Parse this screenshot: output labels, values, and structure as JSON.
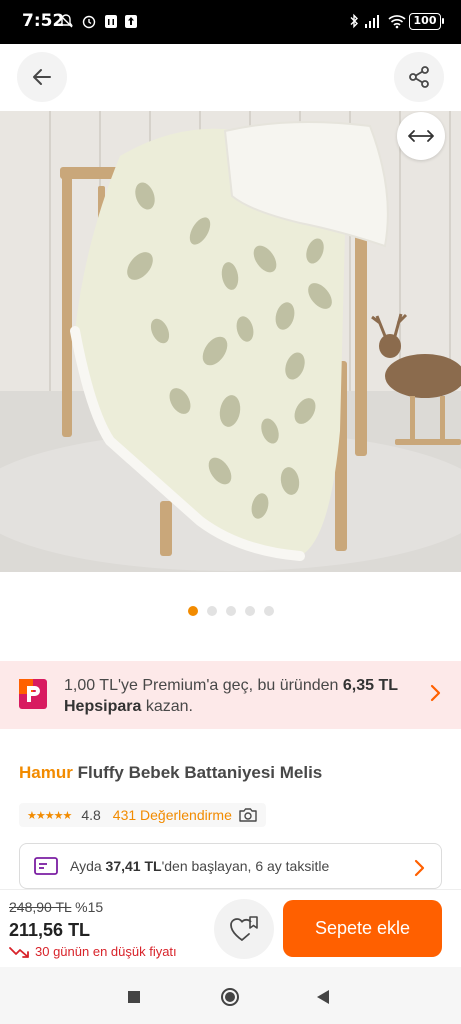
{
  "status_bar": {
    "time": "7:52",
    "battery": "100",
    "icons": [
      "mute-icon",
      "alarm-icon",
      "trash-icon",
      "upload-icon",
      "bluetooth-icon",
      "signal-icon",
      "wifi-icon"
    ]
  },
  "header": {
    "back_icon": "arrow-left-icon",
    "share_icon": "share-icon"
  },
  "gallery": {
    "image_description": "cream fleece baby blanket with leaf pattern draped on wooden chair",
    "expand_icon": "swap-horizontal-icon",
    "page_count": 5,
    "active_index": 0
  },
  "promo": {
    "text_before": "1,00 TL'ye Premium'a geç, bu üründen ",
    "amount": "6,35 TL",
    "brand": "Hepsipara",
    "text_after": " kazan."
  },
  "product": {
    "brand": "Hamur",
    "name": " Fluffy Bebek Battaniyesi Melis",
    "rating": "4.8",
    "reviews": "431 Değerlendirme",
    "stars": "★★★★★"
  },
  "installment": {
    "prefix": "Ayda ",
    "amount": "37,41 TL",
    "suffix": "'den başlayan, 6 ay taksitle"
  },
  "pricing": {
    "old_price": "248,90 TL",
    "discount": "%15",
    "price": "211,56 TL",
    "lowest_note": "30 günün en düşük fiyatı"
  },
  "actions": {
    "add_to_cart": "Sepete ekle"
  },
  "colors": {
    "accent": "#ff6000",
    "brand_orange": "#f28b00",
    "promo_bg": "#fde9e9",
    "alert_red": "#d8232a"
  }
}
